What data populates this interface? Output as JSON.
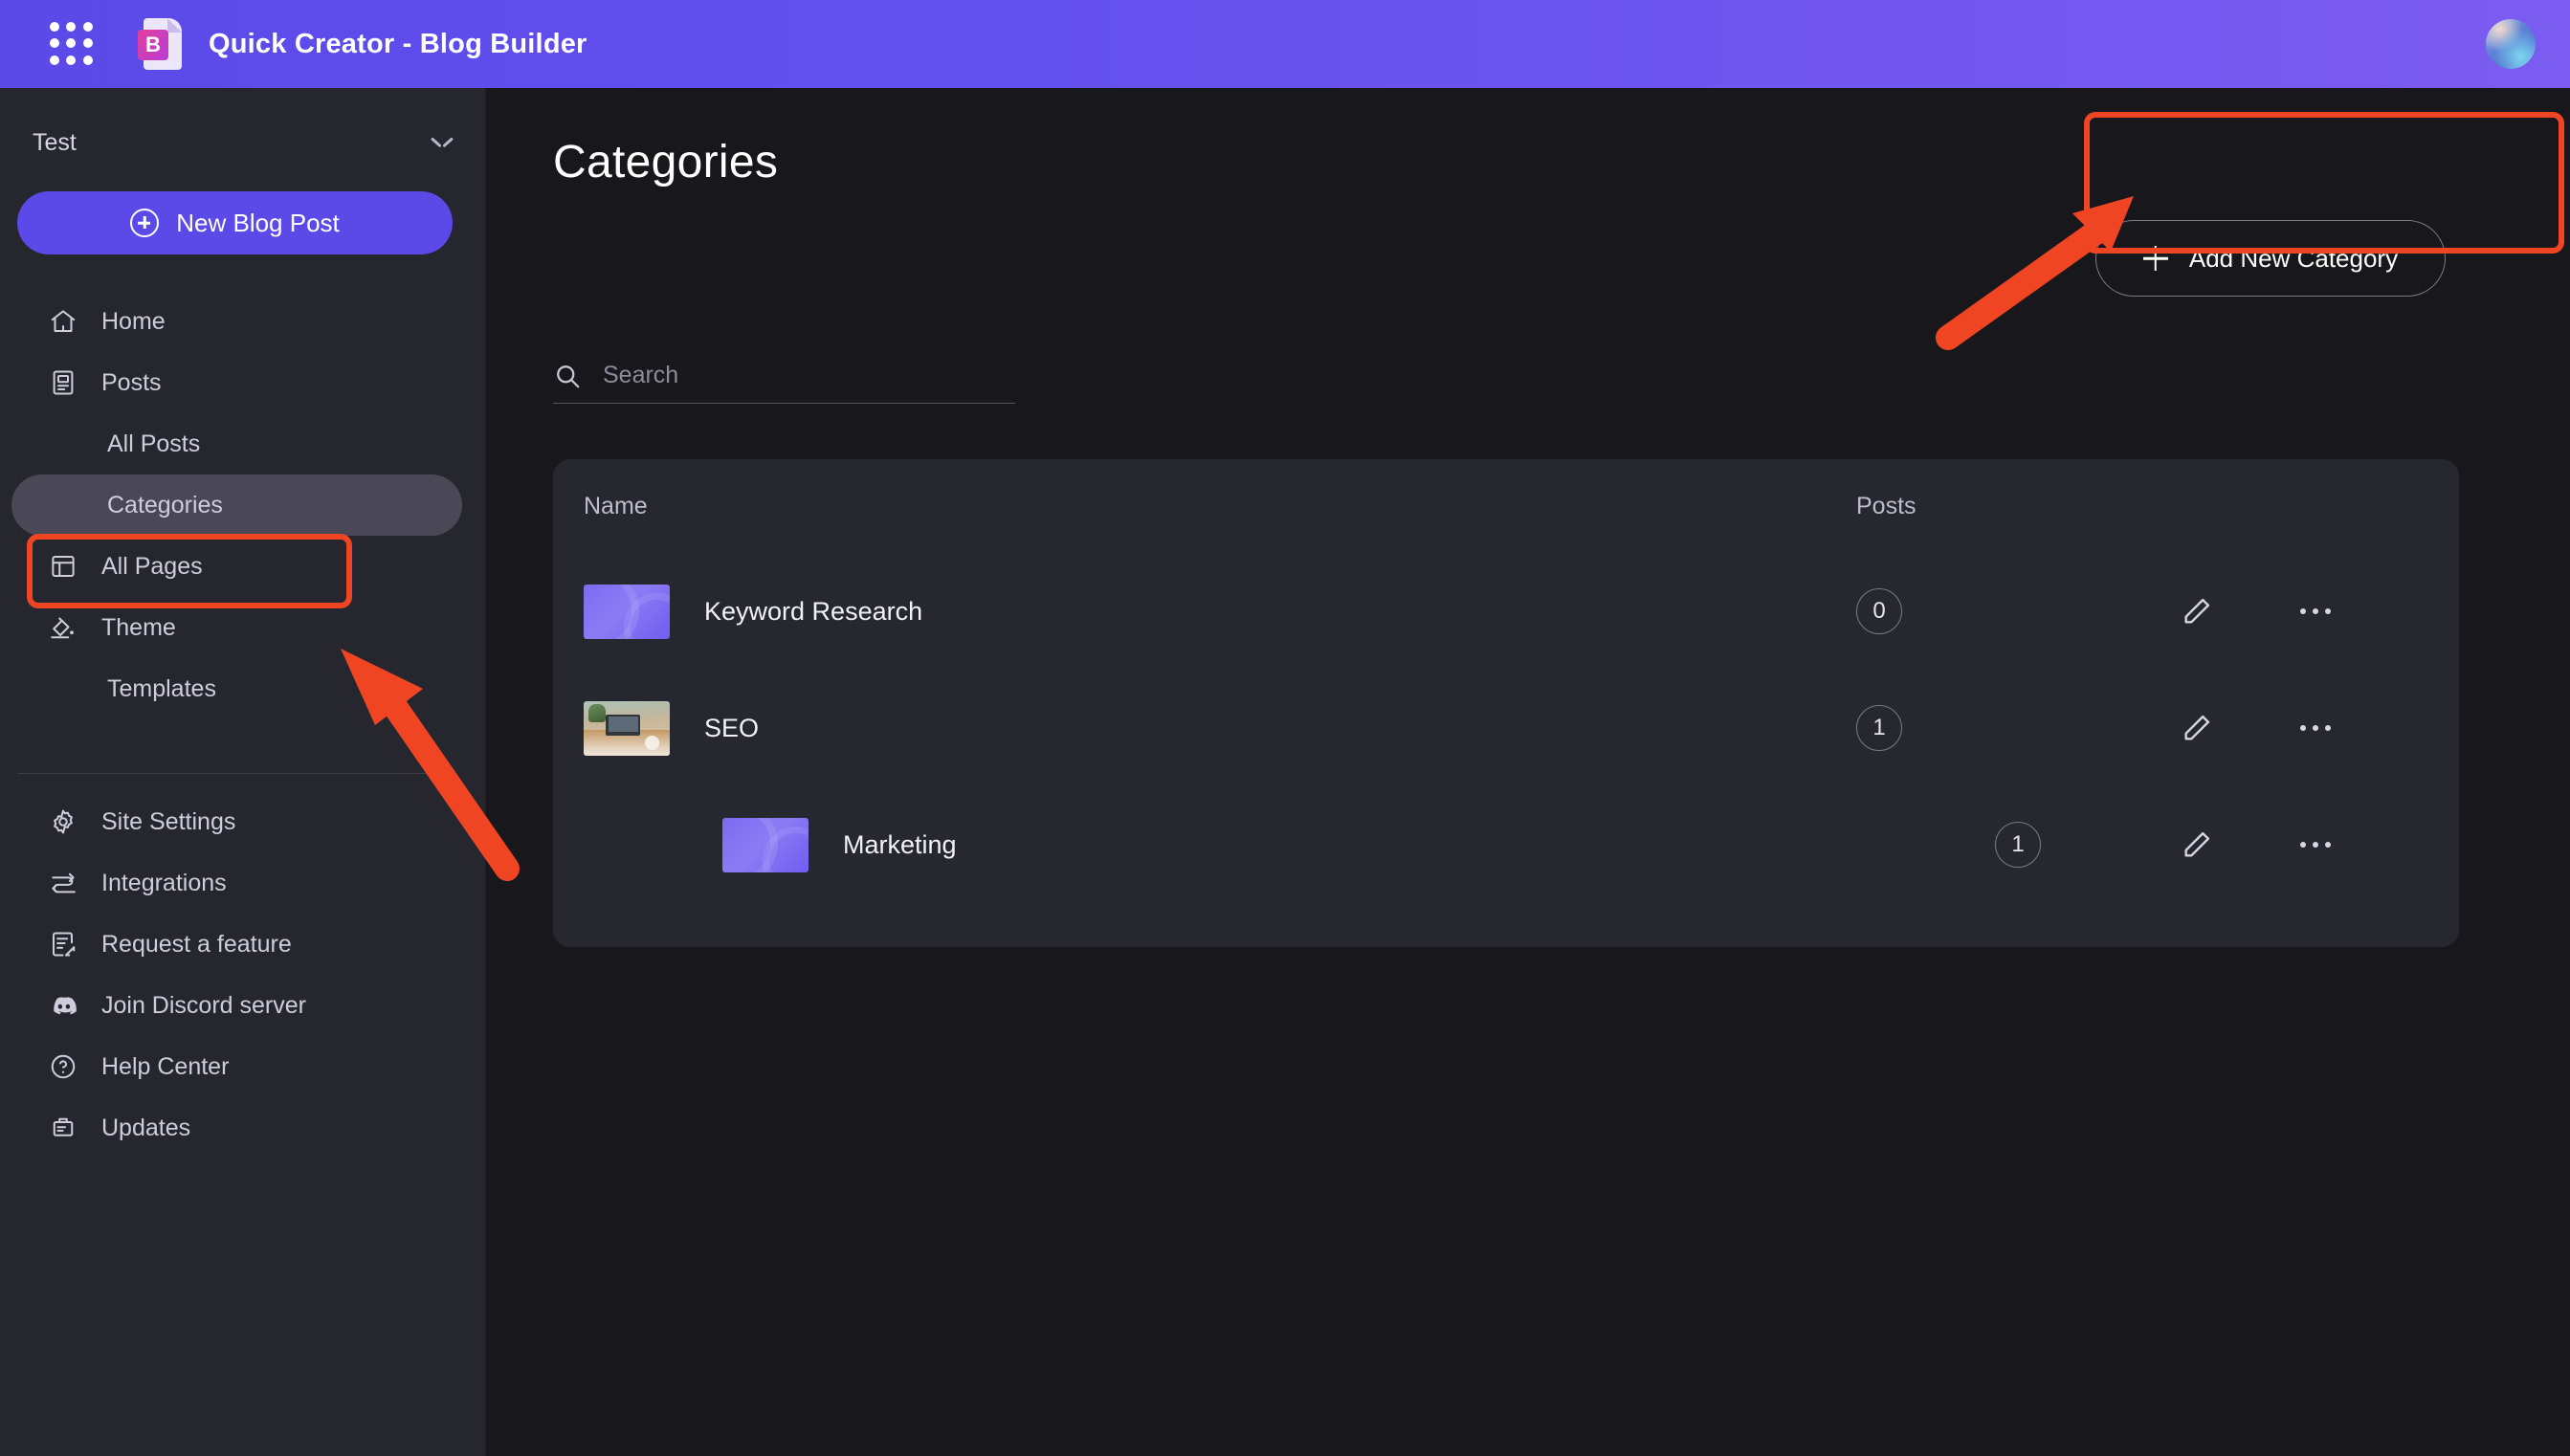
{
  "topbar": {
    "apps_icon": "apps-grid-icon",
    "logo_letter": "B",
    "title": "Quick Creator - Blog Builder",
    "avatar": "user-avatar"
  },
  "sidebar": {
    "site_name": "Test",
    "new_post_label": "New Blog Post",
    "items": [
      {
        "label": "Home",
        "icon": "home-icon",
        "sub": false,
        "active": false
      },
      {
        "label": "Posts",
        "icon": "posts-icon",
        "sub": false,
        "active": false
      },
      {
        "label": "All Posts",
        "icon": "",
        "sub": true,
        "active": false
      },
      {
        "label": "Categories",
        "icon": "",
        "sub": true,
        "active": true
      },
      {
        "label": "All Pages",
        "icon": "pages-icon",
        "sub": false,
        "active": false
      },
      {
        "label": "Theme",
        "icon": "theme-icon",
        "sub": false,
        "active": false
      },
      {
        "label": "Templates",
        "icon": "",
        "sub": true,
        "active": false
      }
    ],
    "bottom_items": [
      {
        "label": "Site Settings",
        "icon": "gear-icon"
      },
      {
        "label": "Integrations",
        "icon": "integrations-icon"
      },
      {
        "label": "Request a feature",
        "icon": "request-feature-icon"
      },
      {
        "label": "Join Discord server",
        "icon": "discord-icon"
      },
      {
        "label": "Help Center",
        "icon": "help-circle-icon"
      },
      {
        "label": "Updates",
        "icon": "updates-icon"
      }
    ]
  },
  "main": {
    "page_title": "Categories",
    "search_placeholder": "Search",
    "search_value": "",
    "add_button_label": "Add New Category",
    "table": {
      "columns": {
        "name": "Name",
        "posts": "Posts"
      },
      "rows": [
        {
          "name": "Keyword Research",
          "posts": "0",
          "thumb": "gradient",
          "indent": 0,
          "edit_icon": "pencil-icon",
          "more_icon": "more-horizontal-icon"
        },
        {
          "name": "SEO",
          "posts": "1",
          "thumb": "photo",
          "indent": 0,
          "edit_icon": "pencil-icon",
          "more_icon": "more-horizontal-icon"
        },
        {
          "name": "Marketing",
          "posts": "1",
          "thumb": "gradient",
          "indent": 1,
          "edit_icon": "pencil-icon",
          "more_icon": "more-horizontal-icon"
        }
      ]
    }
  },
  "annotations": {
    "highlight_color": "#ef4523",
    "boxes": [
      {
        "name": "categories-nav-highlight"
      },
      {
        "name": "add-new-category-highlight"
      }
    ],
    "arrows": [
      {
        "name": "arrow-to-categories"
      },
      {
        "name": "arrow-to-add-new-category"
      }
    ]
  }
}
